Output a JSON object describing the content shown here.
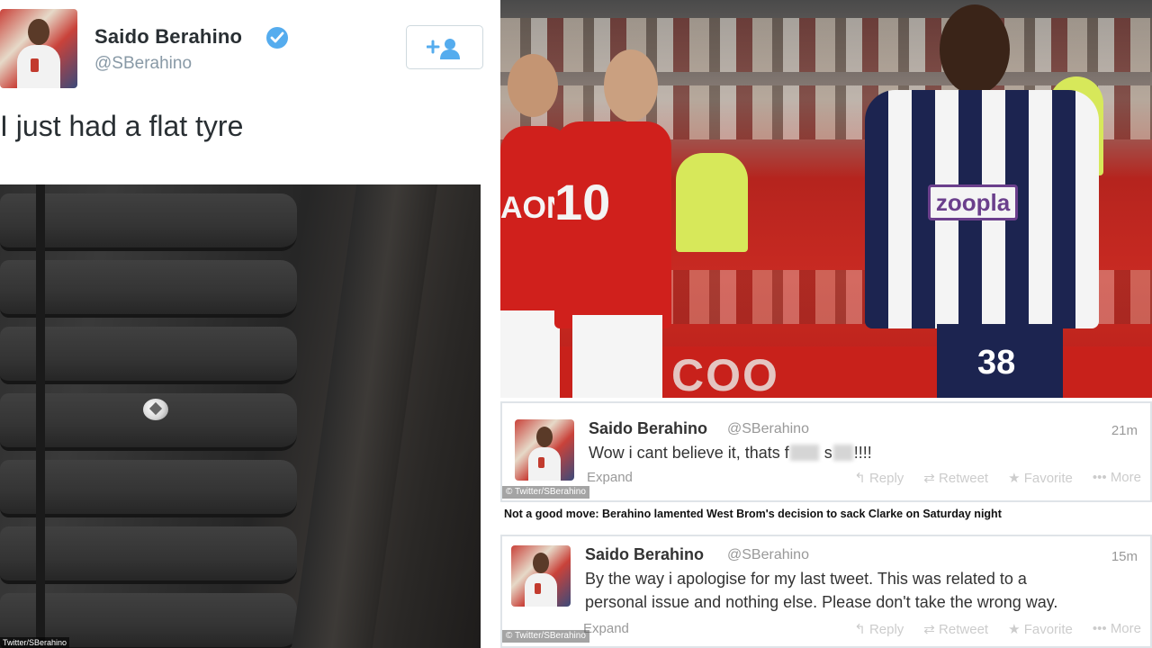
{
  "left_tweet": {
    "name": "Saido Berahino",
    "handle": "@SBerahino",
    "text": "I just had a flat tyre",
    "verified": true,
    "photo_credit": "Twitter/SBerahino"
  },
  "match_photo": {
    "advert": "COO",
    "utd_sponsor": "AON",
    "utd_number": "10",
    "wba_sponsor": "zoopla",
    "wba_number": "38"
  },
  "tweet_1": {
    "name": "Saido Berahino",
    "handle": "@SBerahino",
    "time": "21m",
    "text_before": "Wow i cant believe it, thats f",
    "text_mid": " s",
    "text_after": "!!!!",
    "expand": "Expand",
    "actions": {
      "reply": "Reply",
      "retweet": "Retweet",
      "favorite": "Favorite",
      "more": "More"
    },
    "watermark": "© Twitter/SBerahino"
  },
  "caption": "Not a good move: Berahino lamented West Brom's decision to sack Clarke on Saturday night",
  "tweet_2": {
    "name": "Saido Berahino",
    "handle": "@SBerahino",
    "time": "15m",
    "text_line1": "By the way i apologise for my last tweet. This was related to a",
    "text_line2": "personal issue and nothing else. Please don't take the wrong way.",
    "expand": "Expand",
    "actions": {
      "reply": "Reply",
      "retweet": "Retweet",
      "favorite": "Favorite",
      "more": "More"
    },
    "watermark": "© Twitter/SBerahino"
  },
  "colors": {
    "verified_blue": "#55acee",
    "utd_red": "#d0201c",
    "wba_navy": "#1c2450",
    "zoopla_purple": "#6b3f8c"
  }
}
